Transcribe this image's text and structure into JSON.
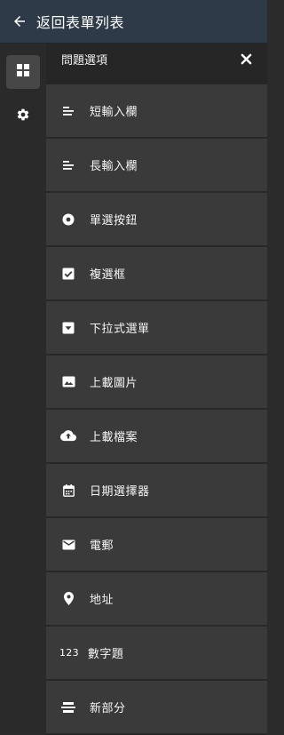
{
  "header": {
    "back_label": "返回表單列表"
  },
  "panel": {
    "title": "問題選項"
  },
  "question_types": [
    {
      "label": "短輸入欄",
      "icon": "short-text-icon"
    },
    {
      "label": "長輸入欄",
      "icon": "long-text-icon"
    },
    {
      "label": "單選按鈕",
      "icon": "radio-button-icon"
    },
    {
      "label": "複選框",
      "icon": "checkbox-icon"
    },
    {
      "label": "下拉式選單",
      "icon": "dropdown-icon"
    },
    {
      "label": "上載圖片",
      "icon": "image-icon"
    },
    {
      "label": "上載檔案",
      "icon": "cloud-upload-icon"
    },
    {
      "label": "日期選擇器",
      "icon": "calendar-icon"
    },
    {
      "label": "電郵",
      "icon": "email-icon"
    },
    {
      "label": "地址",
      "icon": "location-pin-icon"
    },
    {
      "label": "數字題",
      "icon": "number-icon",
      "icon_text": "123"
    },
    {
      "label": "新部分",
      "icon": "section-divider-icon"
    }
  ]
}
